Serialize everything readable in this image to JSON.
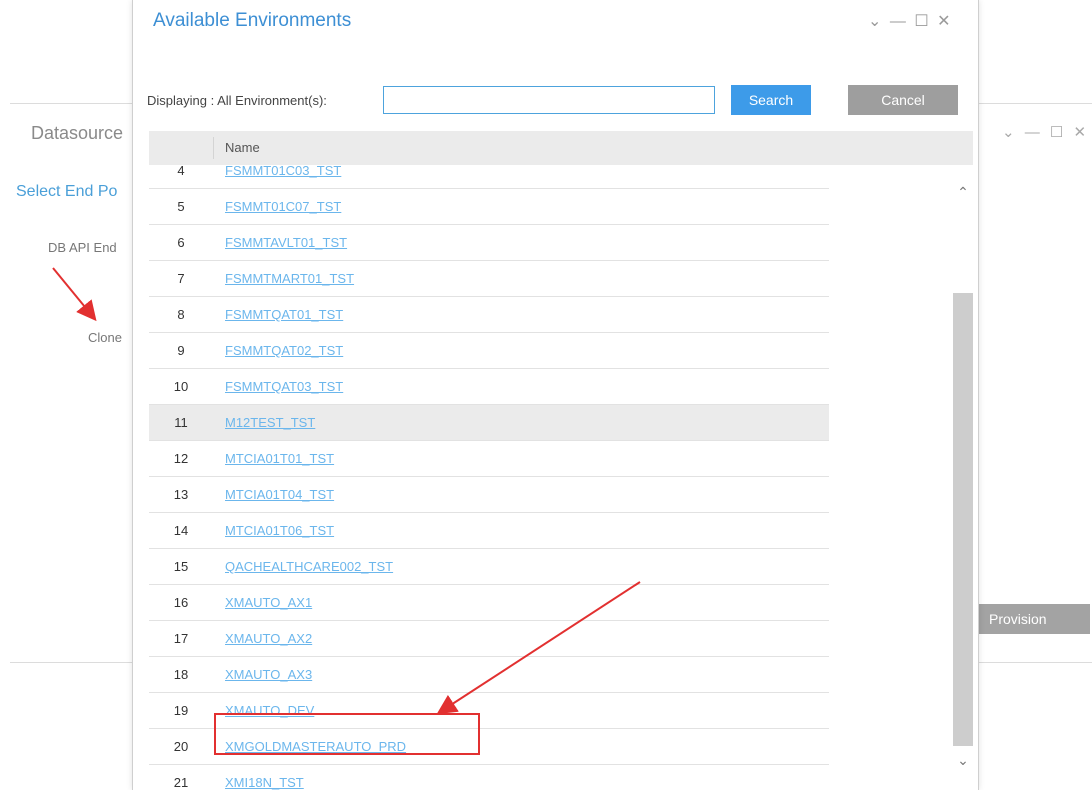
{
  "background": {
    "title": "Datasource",
    "select_label": "Select End Po",
    "db_api_label": "DB API End",
    "clone_label": "Clone",
    "controls": "⌄ — ☐ ✕",
    "provision_label": "Provision"
  },
  "dialog": {
    "title": "Available Environments",
    "controls": {
      "collapse": "⌄",
      "minimize": "—",
      "maximize": "☐",
      "close": "✕"
    },
    "display_label": "Displaying : All Environment(s):",
    "search_value": "",
    "search_button": "Search",
    "cancel_button": "Cancel",
    "column_header": "Name",
    "scroll_up": "⌃",
    "scroll_down": "⌄",
    "rows": [
      {
        "num": "4",
        "name": "FSMMT01C03_TST"
      },
      {
        "num": "5",
        "name": "FSMMT01C07_TST"
      },
      {
        "num": "6",
        "name": "FSMMTAVLT01_TST"
      },
      {
        "num": "7",
        "name": "FSMMTMART01_TST"
      },
      {
        "num": "8",
        "name": "FSMMTQAT01_TST"
      },
      {
        "num": "9",
        "name": "FSMMTQAT02_TST"
      },
      {
        "num": "10",
        "name": "FSMMTQAT03_TST"
      },
      {
        "num": "11",
        "name": "M12TEST_TST"
      },
      {
        "num": "12",
        "name": "MTCIA01T01_TST"
      },
      {
        "num": "13",
        "name": "MTCIA01T04_TST"
      },
      {
        "num": "14",
        "name": "MTCIA01T06_TST"
      },
      {
        "num": "15",
        "name": "QACHEALTHCARE002_TST"
      },
      {
        "num": "16",
        "name": "XMAUTO_AX1"
      },
      {
        "num": "17",
        "name": "XMAUTO_AX2"
      },
      {
        "num": "18",
        "name": "XMAUTO_AX3"
      },
      {
        "num": "19",
        "name": "XMAUTO_DEV"
      },
      {
        "num": "20",
        "name": "XMGOLDMASTERAUTO_PRD"
      },
      {
        "num": "21",
        "name": "XMI18N_TST"
      }
    ]
  }
}
